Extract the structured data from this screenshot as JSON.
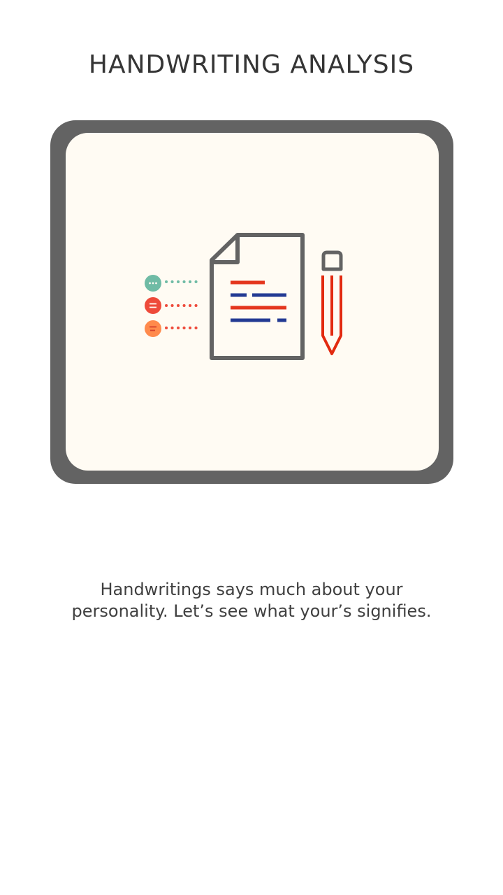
{
  "screen": {
    "title": "HANDWRITING ANALYSIS",
    "description_lines": [
      "Handwritings says much about your",
      "personality. Let’s see what your’s signifies."
    ]
  },
  "illustration": {
    "icons": [
      "teal-dot-bullet-icon",
      "red-lines-bullet-icon",
      "orange-lines-bullet-icon",
      "document-icon",
      "pencil-icon"
    ],
    "colors": {
      "frame": "#636363",
      "card": "#fffbf3",
      "outline": "#636363",
      "teal": "#6fbba5",
      "red": "#ee4a3a",
      "orange": "#ff8a4c",
      "blue": "#233a93",
      "pencil": "#e22a10"
    }
  }
}
